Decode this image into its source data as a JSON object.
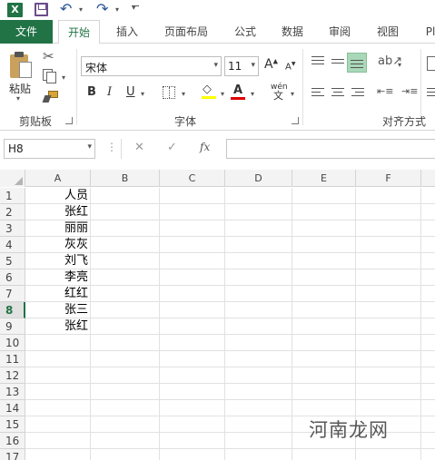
{
  "quick_access": {
    "app_icon_letter": "X",
    "icons": [
      "excel-logo",
      "save-icon",
      "undo-icon",
      "redo-icon",
      "customize-qat-icon"
    ]
  },
  "tabs": [
    {
      "label": "文件",
      "name": "tab-file"
    },
    {
      "label": "开始",
      "name": "tab-home",
      "active": true
    },
    {
      "label": "插入",
      "name": "tab-insert"
    },
    {
      "label": "页面布局",
      "name": "tab-page-layout"
    },
    {
      "label": "公式",
      "name": "tab-formulas"
    },
    {
      "label": "数据",
      "name": "tab-data"
    },
    {
      "label": "审阅",
      "name": "tab-review"
    },
    {
      "label": "视图",
      "name": "tab-view"
    },
    {
      "label": "Pl",
      "name": "tab-power"
    }
  ],
  "ribbon": {
    "clipboard": {
      "paste_label": "粘贴",
      "group_label": "剪贴板"
    },
    "font": {
      "font_name": "宋体",
      "font_size": "11",
      "grow_label": "A",
      "shrink_label": "A",
      "bold": "B",
      "italic": "I",
      "underline": "U",
      "font_color_letter": "A",
      "wen_top": "wén",
      "wen_bottom": "文",
      "group_label": "字体"
    },
    "alignment": {
      "group_label": "对齐方式"
    },
    "colors": {
      "accent": "#217346",
      "fill_highlight": "#ffff00",
      "font_color": "#e00000",
      "align_selected": "#a9d8b8"
    }
  },
  "formula_bar": {
    "name_box": "H8",
    "cancel_glyph": "✕",
    "enter_glyph": "✓",
    "fx_label": "fx",
    "formula": ""
  },
  "sheet": {
    "columns": [
      "A",
      "B",
      "C",
      "D",
      "E",
      "F"
    ],
    "rows": [
      "1",
      "2",
      "3",
      "4",
      "5",
      "6",
      "7",
      "8",
      "9",
      "10",
      "11",
      "12",
      "13",
      "14",
      "15",
      "16",
      "17"
    ],
    "selected_row": "8",
    "col_a_values": [
      "人员",
      "张红",
      "丽丽",
      "灰灰",
      "刘飞",
      "李亮",
      "红红",
      "张三",
      "张红"
    ]
  },
  "watermark": "河南龙网"
}
